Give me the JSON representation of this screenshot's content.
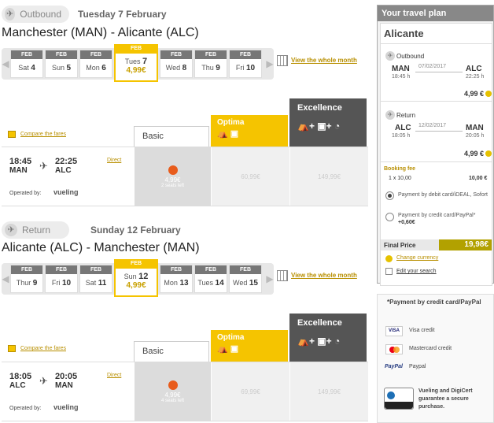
{
  "outbound": {
    "label": "Outbound",
    "date_heading": "Tuesday 7 February",
    "route": "Manchester (MAN) - Alicante (ALC)",
    "dates": [
      {
        "month": "FEB",
        "day": "Sat",
        "num": "4"
      },
      {
        "month": "FEB",
        "day": "Sun",
        "num": "5"
      },
      {
        "month": "FEB",
        "day": "Mon",
        "num": "6"
      },
      {
        "month": "FEB",
        "day": "Tues",
        "num": "7",
        "price": "4,99€",
        "selected": true
      },
      {
        "month": "FEB",
        "day": "Wed",
        "num": "8"
      },
      {
        "month": "FEB",
        "day": "Thu",
        "num": "9"
      },
      {
        "month": "FEB",
        "day": "Fri",
        "num": "10"
      }
    ],
    "view_month": "View the whole month",
    "compare": "Compare the fares",
    "fares": {
      "basic": "Basic",
      "optima": "Optima",
      "excellence": "Excellence"
    },
    "flight": {
      "dep_time": "18:45",
      "arr_time": "22:25",
      "from": "MAN",
      "to": "ALC",
      "type": "Direct",
      "operated": "Operated by:",
      "carrier": "vueling"
    },
    "prices": {
      "basic": "4,99€",
      "seats": "2 seats left",
      "optima": "60,99€",
      "excellence": "149,99€"
    }
  },
  "return": {
    "label": "Return",
    "date_heading": "Sunday 12 February",
    "route": "Alicante (ALC) - Manchester (MAN)",
    "dates": [
      {
        "month": "FEB",
        "day": "Thur",
        "num": "9"
      },
      {
        "month": "FEB",
        "day": "Fri",
        "num": "10"
      },
      {
        "month": "FEB",
        "day": "Sat",
        "num": "11"
      },
      {
        "month": "FEB",
        "day": "Sun",
        "num": "12",
        "price": "4,99€",
        "selected": true
      },
      {
        "month": "FEB",
        "day": "Mon",
        "num": "13"
      },
      {
        "month": "FEB",
        "day": "Tues",
        "num": "14"
      },
      {
        "month": "FEB",
        "day": "Wed",
        "num": "15"
      }
    ],
    "view_month": "View the whole month",
    "compare": "Compare the fares",
    "fares": {
      "basic": "Basic",
      "optima": "Optima",
      "excellence": "Excellence"
    },
    "flight": {
      "dep_time": "18:05",
      "arr_time": "20:05",
      "from": "ALC",
      "to": "MAN",
      "type": "Direct",
      "operated": "Operated by:",
      "carrier": "vueling"
    },
    "prices": {
      "basic": "4,99€",
      "seats": "4 seats left",
      "optima": "69,99€",
      "excellence": "149,99€"
    }
  },
  "plan": {
    "title": "Your travel plan",
    "destination": "Alicante",
    "outbound": {
      "label": "Outbound",
      "from": "MAN",
      "to": "ALC",
      "date": "07/02/2017",
      "dep": "18:45 h",
      "arr": "22:25 h",
      "price": "4,99 €"
    },
    "return": {
      "label": "Return",
      "from": "ALC",
      "to": "MAN",
      "date": "12/02/2017",
      "dep": "18:05 h",
      "arr": "20:05 h",
      "price": "4,99 €"
    },
    "booking_fee_label": "Booking fee",
    "booking_fee_qty": "1 x 10,00",
    "booking_fee_total": "10,00 €",
    "pay_debit": "Payment by debit card/iDEAL, Sofort",
    "pay_credit": "Payment by credit card/PayPal*",
    "pay_credit_extra": "+0,60€",
    "final_label": "Final Price",
    "final_value": "19,98€",
    "change_currency": "Change currency",
    "edit_search": "Edit your search"
  },
  "payinfo": {
    "title": "*Payment by credit card/PayPal",
    "visa": "Visa credit",
    "master": "Mastercard credit",
    "paypal": "Paypal",
    "digicert": "Vueling and DigiCert guarantee a secure purchase."
  }
}
